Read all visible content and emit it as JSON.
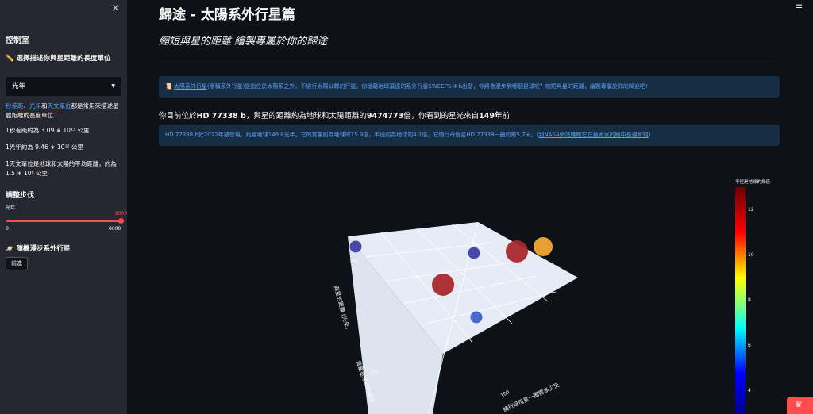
{
  "sidebar": {
    "close_label": "×",
    "title": "控制室",
    "unit_heading": "✏️ 選擇描述你與星距離的長度單位",
    "unit_select": "光年",
    "unit_desc": {
      "link1": "秒差距",
      "sep1": "、",
      "link2": "光年",
      "sep2": "和",
      "link3": "天文單位",
      "rest": "都是常用來描述星體距離的長度單位"
    },
    "conv1": "1秒差距約為 3.09 ∗ 10¹³ 公里",
    "conv2": "1光年約為 9.46 ∗ 10¹² 公里",
    "conv3": "1天文單位是地球和太陽的平均距離，約為 1.5 ∗ 10⁸ 公里",
    "step_heading": "調整步伐",
    "slider": {
      "label": "光年",
      "value": "8000",
      "min": "0",
      "max": "8000",
      "fraction": 1.0
    },
    "walk_heading": "🪐 隨機漫步系外行星",
    "walk_button": "前進"
  },
  "main": {
    "title": "歸途 - 太陽系外行星篇",
    "menu_icon": "☰",
    "subtitle": "縮短與星的距離 繪製專屬於你的歸途",
    "intro": {
      "icon": "📜",
      "link": "太陽系外行星",
      "text": "(簡稱系外行星)是指位於太陽系之外，不繞行太陽公轉的行星。你從離地球最遠的系外行星SWEEPS-4 b出發，你將會漫步到哪個星球呢？縮短與星的距離，繪製專屬於你的歸途吧!"
    },
    "position": {
      "pre": "你目前位於",
      "planet": "HD 77338 b",
      "mid1": "，與星的距離約為地球和太陽距離的",
      "ratio": "9474773",
      "mid2": "倍，你看到的星光來自",
      "years": "149年",
      "post": "前"
    },
    "planet_info": {
      "text": "HD 77338 b於2012年被發現，距離地球149.8光年。它的質量約為地球的15.9倍，半徑約為地球的4.1倍。它繞行母恆星HD 77338一圈約需5.7天。(",
      "link": "到NASA網站瞧瞧它在藝術家的眼中長得如何",
      "close": ")"
    }
  },
  "chart_data": {
    "type": "scatter",
    "title": "",
    "axes": {
      "y_label": "與星的距離 (光年)",
      "y_tick": "10k",
      "x_label": "質量是地球的幾倍",
      "x_tick": "100",
      "z_label": "繞行母恆星一圈需多少天",
      "z_tick": "100"
    },
    "colorbar": {
      "title": "半徑是地球的幾倍",
      "ticks": [
        "12",
        "10",
        "8",
        "6",
        "4"
      ],
      "range": [
        3,
        13
      ]
    },
    "points": [
      {
        "radius_ratio": 3.5,
        "size": "small"
      },
      {
        "radius_ratio": 3.5,
        "size": "small"
      },
      {
        "radius_ratio": 12.5,
        "size": "large"
      },
      {
        "radius_ratio": 12.8,
        "size": "large"
      },
      {
        "radius_ratio": 9,
        "size": "medium"
      },
      {
        "radius_ratio": 4.1,
        "size": "small"
      }
    ],
    "point_colors": [
      "#3f3fa6",
      "#3f3fa6",
      "#a8282c",
      "#a8282c",
      "#f2a933",
      "#3d63c8"
    ]
  },
  "colors": {
    "accent": "#ff4b4b",
    "info_bg": "#172d43",
    "link": "#5aa0f2",
    "sidebar_bg": "#262730",
    "page_bg": "#0e1117"
  }
}
